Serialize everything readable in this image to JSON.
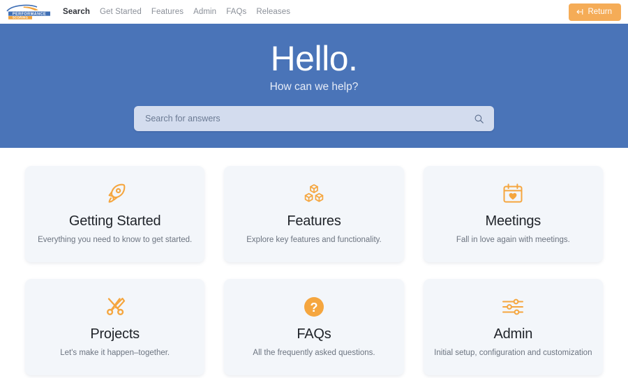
{
  "colors": {
    "hero_blue": "#4a74b8",
    "accent_orange": "#f5ac57",
    "card_bg": "#f3f6fa",
    "search_bg": "#d3dcee"
  },
  "navbar": {
    "logo": {
      "name": "performance-scoring-logo",
      "line1": "PERFORMANCE",
      "line2": "SCORING"
    },
    "links": [
      {
        "label": "Search",
        "active": true
      },
      {
        "label": "Get Started",
        "active": false
      },
      {
        "label": "Features",
        "active": false
      },
      {
        "label": "Admin",
        "active": false
      },
      {
        "label": "FAQs",
        "active": false
      },
      {
        "label": "Releases",
        "active": false
      }
    ],
    "return_button": {
      "label": "Return",
      "icon": "arrow-left-to-bar-icon"
    }
  },
  "hero": {
    "title": "Hello.",
    "subtitle": "How can we help?",
    "search": {
      "placeholder": "Search for answers",
      "value": "",
      "icon": "search-icon"
    }
  },
  "cards": [
    {
      "icon": "rocket-icon",
      "title": "Getting Started",
      "desc": "Everything you need to know to get started."
    },
    {
      "icon": "boxes-icon",
      "title": "Features",
      "desc": "Explore key features and functionality."
    },
    {
      "icon": "calendar-heart-icon",
      "title": "Meetings",
      "desc": "Fall in love again with meetings."
    },
    {
      "icon": "tools-icon",
      "title": "Projects",
      "desc": "Let's make it happen–together."
    },
    {
      "icon": "question-circle-icon",
      "title": "FAQs",
      "desc": "All the frequently asked questions."
    },
    {
      "icon": "sliders-icon",
      "title": "Admin",
      "desc": "Initial setup, configuration and customization"
    }
  ]
}
